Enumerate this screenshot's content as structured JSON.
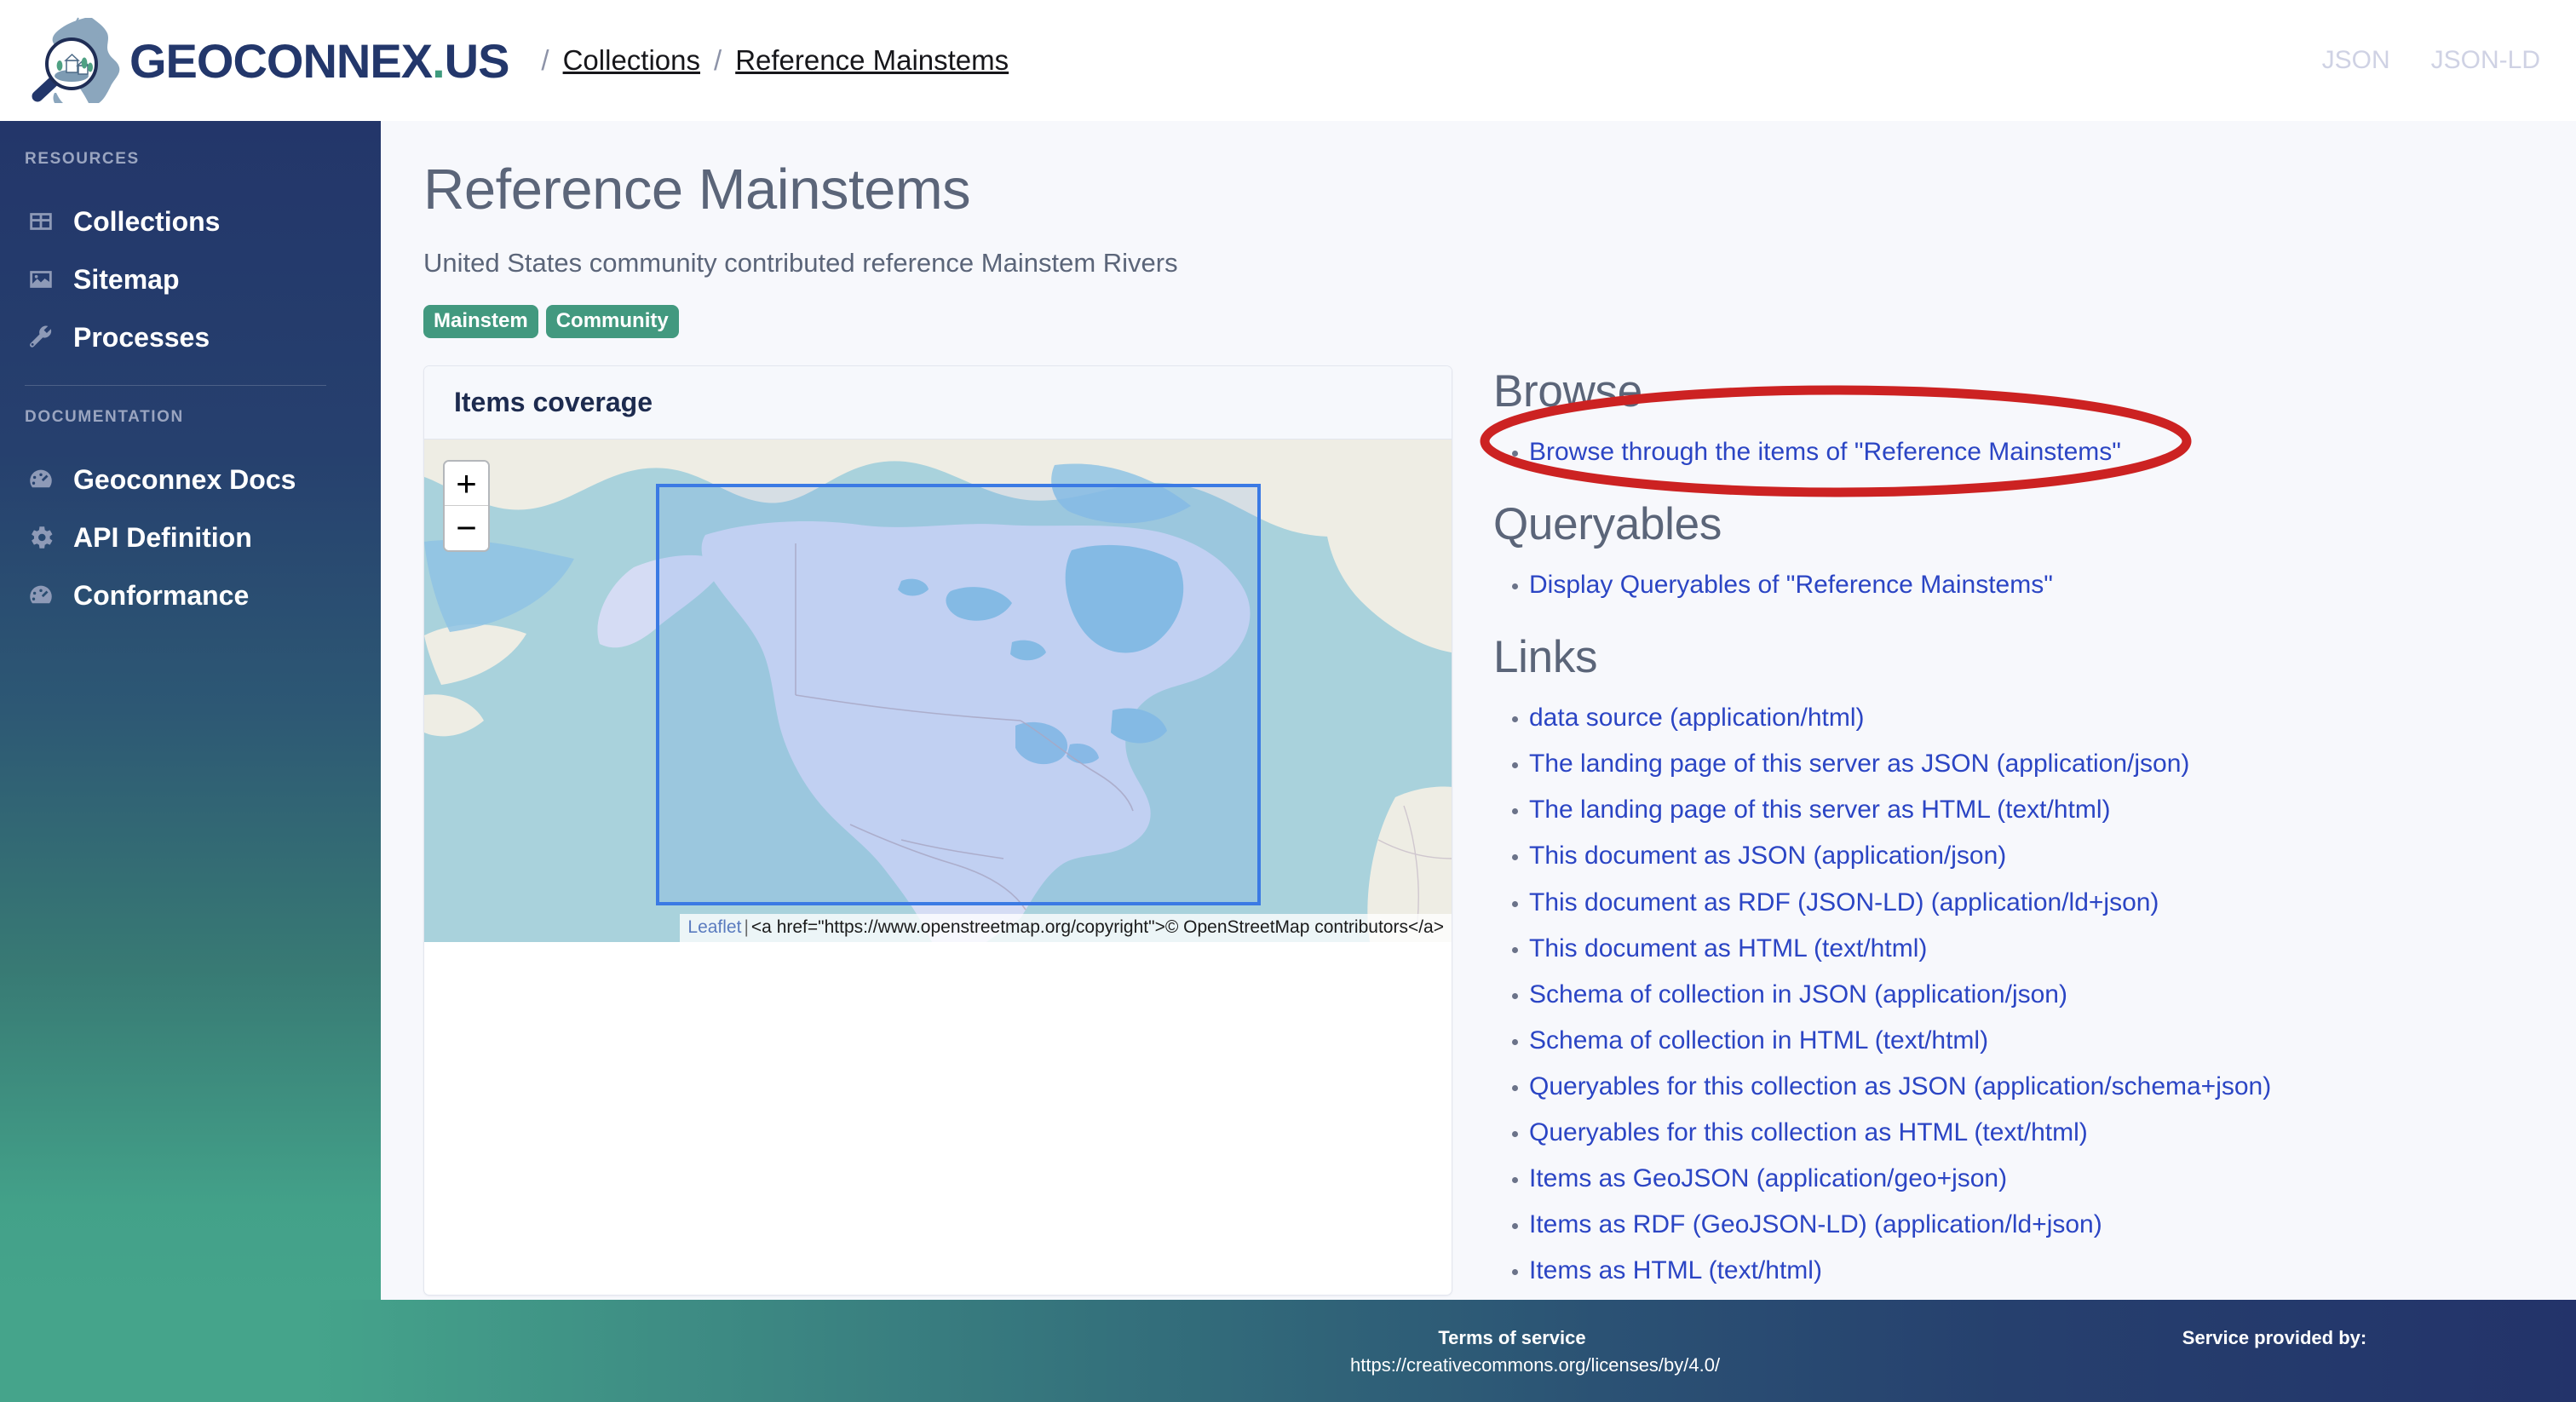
{
  "header": {
    "brand_geo": "GEOCONNEX",
    "brand_dot": ".",
    "brand_us": "US",
    "breadcrumb": [
      {
        "label": "Collections"
      },
      {
        "label": "Reference Mainstems"
      }
    ],
    "separator": "/",
    "actions": [
      {
        "label": "JSON"
      },
      {
        "label": "JSON-LD"
      }
    ]
  },
  "sidebar": {
    "group_resources_label": "RESOURCES",
    "group_documentation_label": "DOCUMENTATION",
    "resources": [
      {
        "label": "Collections",
        "icon": "table-icon"
      },
      {
        "label": "Sitemap",
        "icon": "image-icon"
      },
      {
        "label": "Processes",
        "icon": "wrench-icon"
      }
    ],
    "documentation": [
      {
        "label": "Geoconnex Docs",
        "icon": "gauge-icon"
      },
      {
        "label": "API Definition",
        "icon": "gear-icon"
      },
      {
        "label": "Conformance",
        "icon": "gauge-icon"
      }
    ]
  },
  "main": {
    "title": "Reference Mainstems",
    "subtitle": "United States community contributed reference Mainstem Rivers",
    "badges": [
      {
        "label": "Mainstem"
      },
      {
        "label": "Community"
      }
    ],
    "map_card": {
      "heading": "Items coverage",
      "zoom_in_label": "+",
      "zoom_out_label": "−",
      "attribution_leaflet": "Leaflet",
      "attribution_sep": "|",
      "attribution_text": "<a href=\"https://www.openstreetmap.org/copyright\">© OpenStreetMap contributors</a>"
    },
    "browse": {
      "heading": "Browse",
      "items": [
        {
          "label": "Browse through the items of \"Reference Mainstems\""
        }
      ]
    },
    "queryables": {
      "heading": "Queryables",
      "items": [
        {
          "label": "Display Queryables of \"Reference Mainstems\""
        }
      ]
    },
    "links": {
      "heading": "Links",
      "items": [
        {
          "label": "data source (application/html)"
        },
        {
          "label": "The landing page of this server as JSON (application/json)"
        },
        {
          "label": "The landing page of this server as HTML (text/html)"
        },
        {
          "label": "This document as JSON (application/json)"
        },
        {
          "label": "This document as RDF (JSON-LD) (application/ld+json)"
        },
        {
          "label": "This document as HTML (text/html)"
        },
        {
          "label": "Schema of collection in JSON (application/json)"
        },
        {
          "label": "Schema of collection in HTML (text/html)"
        },
        {
          "label": "Queryables for this collection as JSON (application/schema+json)"
        },
        {
          "label": "Queryables for this collection as HTML (text/html)"
        },
        {
          "label": "Items as GeoJSON (application/geo+json)"
        },
        {
          "label": "Items as RDF (GeoJSON-LD) (application/ld+json)"
        },
        {
          "label": "Items as HTML (text/html)"
        }
      ]
    }
  },
  "annotation": {
    "shape": "ellipse",
    "color": "#cc2222",
    "target": "Browse through the items of \"Reference Mainstems\""
  },
  "footer": {
    "terms_title": "Terms of service",
    "terms_url": "https://creativecommons.org/licenses/by/4.0/",
    "provider_title": "Service provided by:"
  },
  "colors": {
    "brand_navy": "#23376b",
    "accent_green": "#42997f",
    "link_blue": "#2b45c4",
    "annotation_red": "#cc2222",
    "page_bg": "#f7f8fc"
  }
}
